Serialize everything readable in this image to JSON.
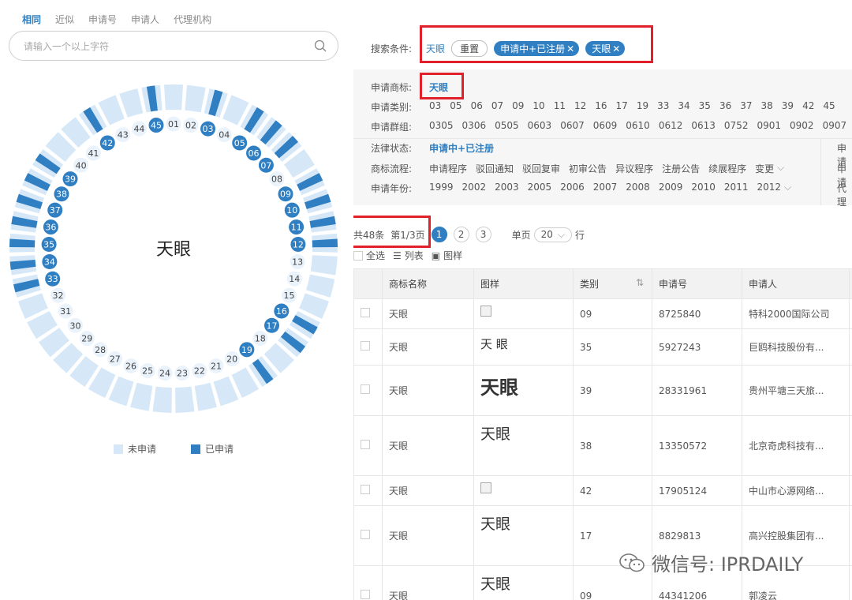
{
  "left": {
    "tabs": [
      "相同",
      "近似",
      "申请号",
      "申请人",
      "代理机构"
    ],
    "active_tab": 0,
    "search": {
      "placeholder": "请输入一个以上字符",
      "value": ""
    },
    "center_label": "天眼",
    "ring": {
      "segments": [
        "01",
        "02",
        "03",
        "04",
        "05",
        "06",
        "07",
        "08",
        "09",
        "10",
        "11",
        "12",
        "13",
        "14",
        "15",
        "16",
        "17",
        "18",
        "19",
        "20",
        "21",
        "22",
        "23",
        "24",
        "25",
        "26",
        "27",
        "28",
        "29",
        "30",
        "31",
        "32",
        "33",
        "34",
        "35",
        "36",
        "37",
        "38",
        "39",
        "40",
        "41",
        "42",
        "43",
        "44",
        "45"
      ],
      "applied": [
        "03",
        "05",
        "06",
        "07",
        "09",
        "10",
        "11",
        "12",
        "16",
        "17",
        "19",
        "33",
        "34",
        "35",
        "36",
        "37",
        "38",
        "39",
        "42",
        "45"
      ]
    },
    "legend": {
      "not_applied": "未申请",
      "applied": "已申请"
    },
    "colors": {
      "not_applied": "#d6e8f8",
      "applied": "#2f7fc2"
    }
  },
  "right": {
    "conditions": {
      "label": "搜索条件:",
      "keyword": "天眼",
      "reset_label": "重置",
      "chips": [
        "申请中+已注册",
        "天眼"
      ]
    },
    "filters": {
      "name": {
        "label": "申请商标:",
        "value": "天眼"
      },
      "classes": {
        "label": "申请类别:",
        "values": [
          "03",
          "05",
          "06",
          "07",
          "09",
          "10",
          "11",
          "12",
          "16",
          "17",
          "19",
          "33",
          "34",
          "35",
          "36",
          "37",
          "38",
          "39",
          "42",
          "45"
        ]
      },
      "groups": {
        "label": "申请群组:",
        "values": [
          "0305",
          "0306",
          "0505",
          "0603",
          "0607",
          "0609",
          "0610",
          "0612",
          "0613",
          "0752",
          "0901",
          "0902",
          "0907"
        ]
      },
      "legal": {
        "label": "法律状态:",
        "value": "申请中+已注册"
      },
      "process": {
        "label": "商标流程:",
        "values": [
          "申请程序",
          "驳回通知",
          "驳回复审",
          "初审公告",
          "异议程序",
          "注册公告",
          "续展程序",
          "变更"
        ]
      },
      "years": {
        "label": "申请年份:",
        "values": [
          "1999",
          "2002",
          "2003",
          "2005",
          "2006",
          "2007",
          "2008",
          "2009",
          "2010",
          "2011",
          "2012"
        ]
      },
      "side_labels": [
        "申请",
        "申请",
        "代理"
      ]
    },
    "pager": {
      "count": "共48条",
      "page": "第1/3页",
      "pages": [
        "1",
        "2",
        "3"
      ],
      "per_page_label": "单页",
      "per_page_value": "20",
      "per_page_suffix": "行"
    },
    "view": {
      "select_all": "全选",
      "list": "列表",
      "pattern": "图样"
    },
    "table": {
      "headers": [
        "商标名称",
        "图样",
        "类别",
        "申请号",
        "申请人"
      ],
      "rows": [
        {
          "name": "天眼",
          "sample": "",
          "sample_type": "broken",
          "cls": "09",
          "appno": "8725840",
          "applicant": "特科2000国际公司"
        },
        {
          "name": "天眼",
          "sample": "天 眼",
          "sample_type": "small",
          "cls": "35",
          "appno": "5927243",
          "applicant": "巨鸥科技股份有..."
        },
        {
          "name": "天眼",
          "sample": "天眼",
          "sample_type": "bold",
          "cls": "39",
          "appno": "28331961",
          "applicant": "贵州平塘三天旅..."
        },
        {
          "name": "天眼",
          "sample": "天眼",
          "sample_type": "medium",
          "cls": "38",
          "appno": "13350572",
          "applicant": "北京奇虎科技有..."
        },
        {
          "name": "天眼",
          "sample": "",
          "sample_type": "empty",
          "cls": "42",
          "appno": "17905124",
          "applicant": "中山市心源网络..."
        },
        {
          "name": "天眼",
          "sample": "天眼",
          "sample_type": "medium",
          "cls": "17",
          "appno": "8829813",
          "applicant": "高兴控股集团有..."
        },
        {
          "name": "天眼",
          "sample": "天眼",
          "sample_type": "medium",
          "cls": "09",
          "appno": "44341206",
          "applicant": "郭凌云"
        }
      ]
    }
  },
  "watermark": "微信号: IPRDAILY"
}
